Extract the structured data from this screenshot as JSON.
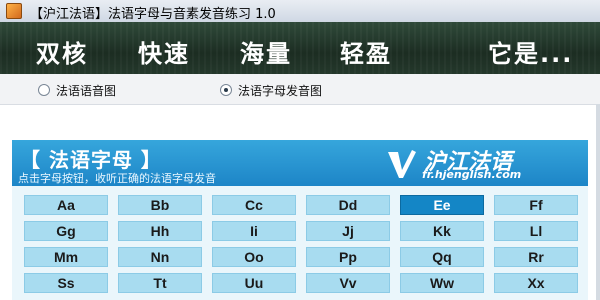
{
  "window": {
    "title": "【沪江法语】法语字母与音素发音练习 1.0"
  },
  "banner": {
    "words": [
      "双核",
      "快速",
      "海量",
      "轻盈",
      "它是..."
    ]
  },
  "options": [
    {
      "label": "法语语音图",
      "selected": false
    },
    {
      "label": "法语字母发音图",
      "selected": true
    }
  ],
  "panel": {
    "title": "【 法语字母 】",
    "subtitle": "点击字母按钮，收听正确的法语字母发音",
    "brand": "沪江法语",
    "domain": "fr.hjenglish.com"
  },
  "letters": [
    [
      "Aa",
      "Bb",
      "Cc",
      "Dd",
      "Ee",
      "Ff"
    ],
    [
      "Gg",
      "Hh",
      "Ii",
      "Jj",
      "Kk",
      "Ll"
    ],
    [
      "Mm",
      "Nn",
      "Oo",
      "Pp",
      "Qq",
      "Rr"
    ],
    [
      "Ss",
      "Tt",
      "Uu",
      "Vv",
      "Ww",
      "Xx"
    ]
  ],
  "active_letter": "Ee",
  "colors": {
    "header": "#1d85c7",
    "key": "#a8dcf0",
    "key_active": "#1486c6",
    "banner": "#24382b"
  }
}
